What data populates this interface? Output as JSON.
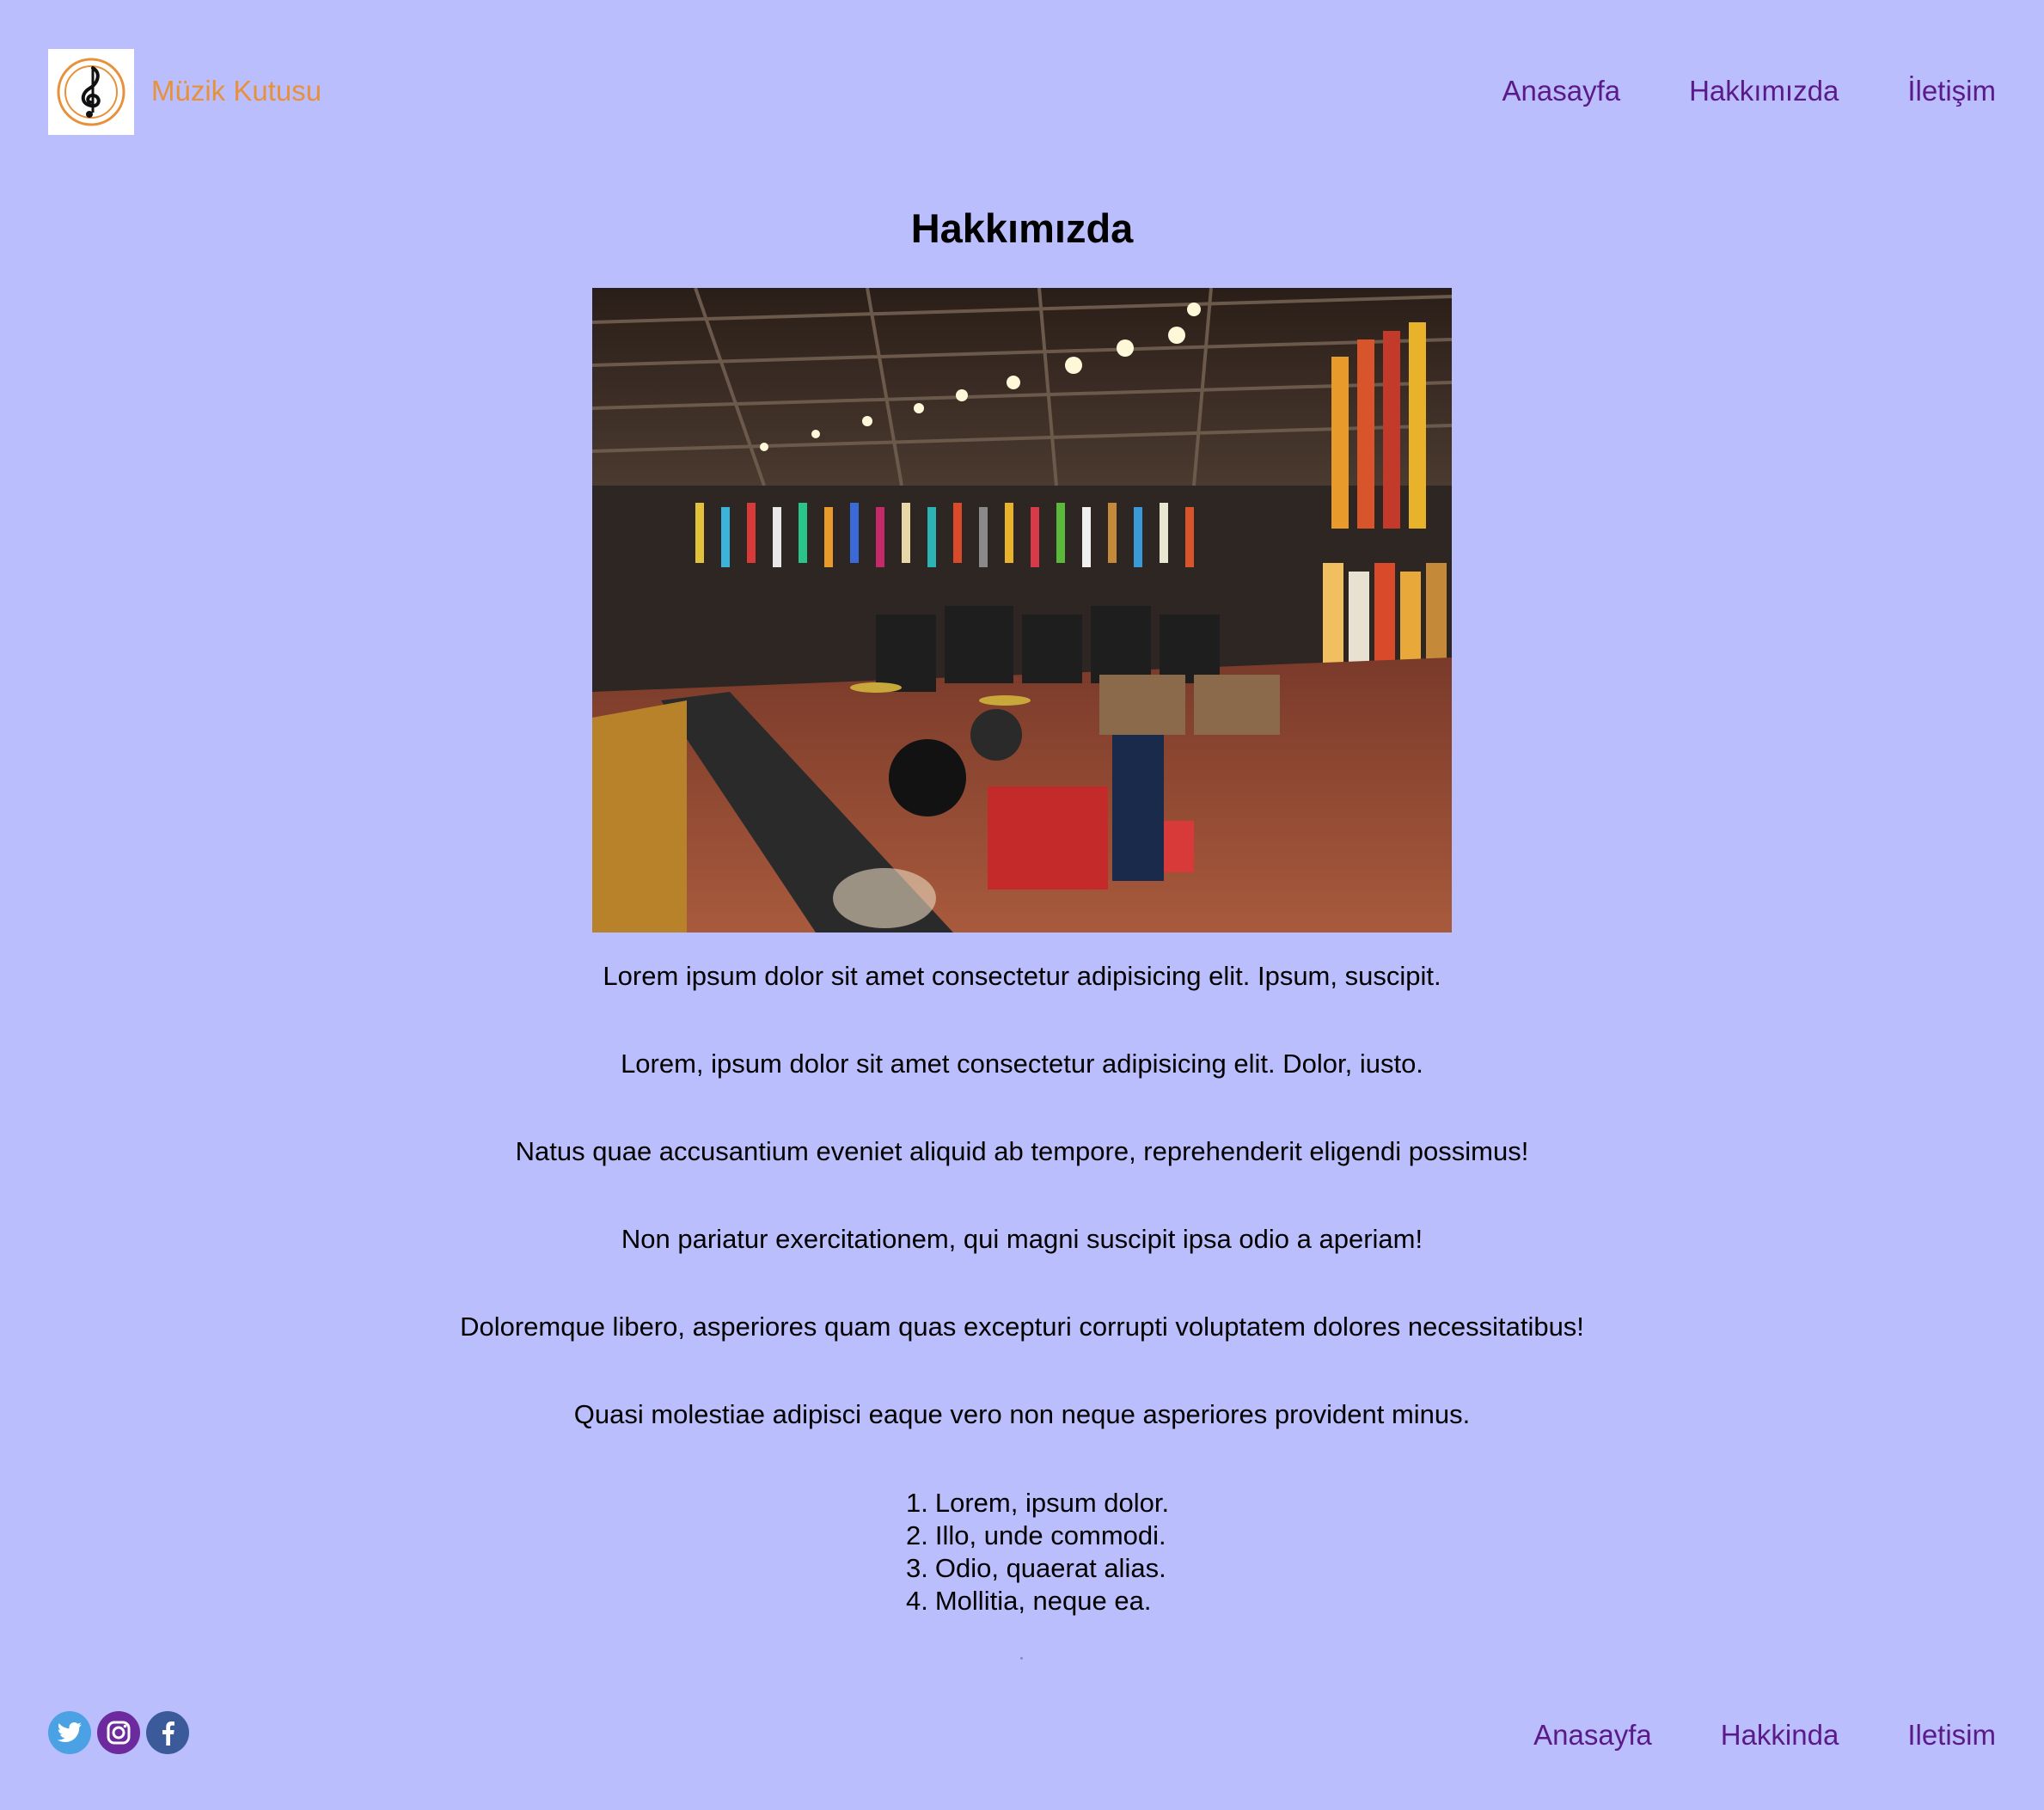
{
  "header": {
    "brand": "Müzik Kutusu",
    "logo_icon": "treble-clef-icon",
    "nav": [
      "Anasayfa",
      "Hakkımızda",
      "İletişim"
    ]
  },
  "main": {
    "title": "Hakkımızda",
    "image_alt": "music store interior",
    "paragraphs": [
      "Lorem ipsum dolor sit amet consectetur adipisicing elit. Ipsum, suscipit.",
      "Lorem, ipsum dolor sit amet consectetur adipisicing elit. Dolor, iusto.",
      "Natus quae accusantium eveniet aliquid ab tempore, reprehenderit eligendi possimus!",
      "Non pariatur exercitationem, qui magni suscipit ipsa odio a aperiam!",
      "Doloremque libero, asperiores quam quas excepturi corrupti voluptatem dolores necessitatibus!",
      "Quasi molestiae adipisci eaque vero non neque asperiores provident minus."
    ],
    "list": [
      "Lorem, ipsum dolor.",
      "Illo, unde commodi.",
      "Odio, quaerat alias.",
      "Mollitia, neque ea."
    ],
    "list_numbers": [
      "1.",
      "2.",
      "3.",
      "4."
    ]
  },
  "footer": {
    "social_icons": [
      "twitter-icon",
      "instagram-icon",
      "facebook-icon"
    ],
    "nav": [
      "Anasayfa",
      "Hakkinda",
      "Iletisim"
    ]
  },
  "colors": {
    "background": "#bbbefc",
    "brand": "#e8913a",
    "nav_link": "#5a1a8a"
  }
}
